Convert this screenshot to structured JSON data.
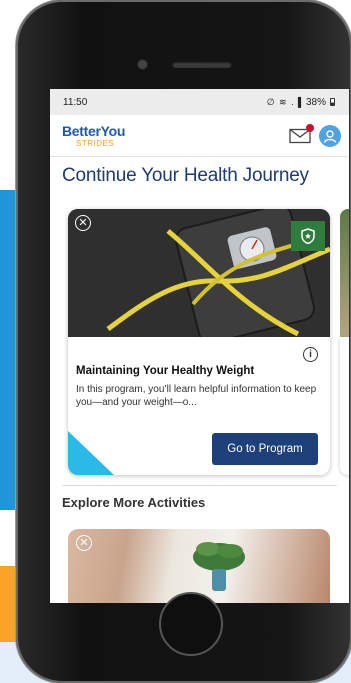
{
  "status_bar": {
    "time": "11:50",
    "signal_icons": "∅ ≋ .▐",
    "battery": "38%"
  },
  "app": {
    "logo_main": "BetterYou",
    "logo_sub": "STRIDES",
    "mail_icon": "envelope-icon",
    "notification_color": "#c8102e",
    "avatar_icon": "user-icon"
  },
  "main": {
    "section_title": "Continue Your Health Journey",
    "card": {
      "title": "Maintaining Your Healthy Weight",
      "description": "In this program, you’ll learn helpful information to keep you—and your weight—o...",
      "button_label": "Go to Program",
      "badge_icon": "shield-star-icon",
      "badge_color": "#2e7d3e",
      "button_color": "#1d3f7a",
      "accent_color": "#2bbae8"
    },
    "section2_title": "Explore More Activities"
  }
}
